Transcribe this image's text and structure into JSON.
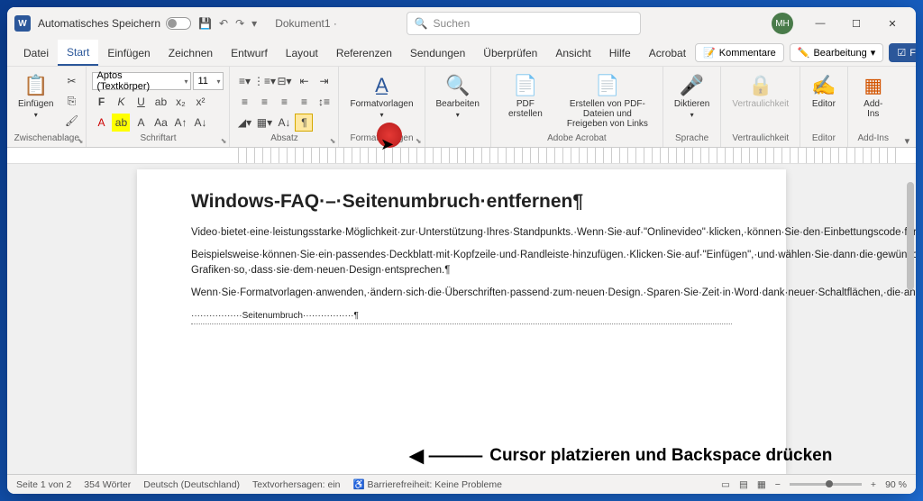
{
  "titlebar": {
    "autosave": "Automatisches Speichern",
    "doctitle": "Dokument1 ·",
    "searchPlaceholder": "Suchen",
    "avatar": "MH"
  },
  "tabs": [
    "Datei",
    "Start",
    "Einfügen",
    "Zeichnen",
    "Entwurf",
    "Layout",
    "Referenzen",
    "Sendungen",
    "Überprüfen",
    "Ansicht",
    "Hilfe",
    "Acrobat"
  ],
  "tabsRight": {
    "comments": "Kommentare",
    "editing": "Bearbeitung",
    "share": "Freigeben"
  },
  "ribbon": {
    "clipboard": {
      "paste": "Einfügen",
      "label": "Zwischenablage"
    },
    "font": {
      "name": "Aptos (Textkörper)",
      "size": "11",
      "label": "Schriftart"
    },
    "paragraph": {
      "label": "Absatz"
    },
    "styles": {
      "btn": "Formatvorlagen",
      "label": "Formatvorlagen"
    },
    "editing": {
      "btn": "Bearbeiten"
    },
    "pdf": {
      "create": "PDF erstellen",
      "createShare": "Erstellen von PDF-Dateien und Freigeben von Links",
      "label": "Adobe Acrobat"
    },
    "dictate": {
      "btn": "Diktieren",
      "label": "Sprache"
    },
    "conf": {
      "btn": "Vertraulichkeit",
      "label": "Vertraulichkeit"
    },
    "editor": {
      "btn": "Editor",
      "label": "Editor"
    },
    "addins": {
      "btn": "Add-Ins",
      "label": "Add-Ins"
    }
  },
  "document": {
    "title": "Windows-FAQ·–·Seitenumbruch·entfernen¶",
    "p1": "Video·bietet·eine·leistungsstarke·Möglichkeit·zur·Unterstützung·Ihres·Standpunkts.·Wenn·Sie·auf·\"Onlinevideo\"·klicken,·können·Sie·den·Einbettungscode·für·das·Video·einfügen,·das·hinzugefügt·werden·soll.·Sie·können·auch·ein·Stichwort·eingeben,·um·online·nach·dem·Videoclip·zu·suchen,·der·optimal·zu·Ihrem·Dokument·passt.·Damit·Ihr·Dokument·ein·professionelles·Aussehen·erhält,·stellt·Word·einander·ergänzende·Designs·für·Kopfzeile,·Fußzeile,·Deckblatt·und·Textfelder·zur·Verfügung.¶",
    "p2": "Beispielsweise·können·Sie·ein·passendes·Deckblatt·mit·Kopfzeile·und·Randleiste·hinzufügen.·Klicken·Sie·auf·\"Einfügen\",·und·wählen·Sie·dann·die·gewünschten·Elemente·aus·den·verschiedenen·Katalogen·aus.·Designs·und·Formatvorlagen·helfen·auch·dabei,·die·Elemente·Ihres·Dokuments·aufeinander·abzustimmen.·Wenn·Sie·auf·\"Entwurf\"·klicken·und·ein·neues·Design·auswählen,·ändern·sich·die·Grafiken,·Diagramme·und·SmartArt-Grafiken·so,·dass·sie·dem·neuen·Design·entsprechen.¶",
    "p3": "Wenn·Sie·Formatvorlagen·anwenden,·ändern·sich·die·Überschriften·passend·zum·neuen·Design.·Sparen·Sie·Zeit·in·Word·dank·neuer·Schaltflächen,·die·angezeigt·werden,·wo·Sie·sie·benötigen.·Zum·Ändern·der·Weise,·in·der·sich·ein·Bild·in·Ihr·Dokument·einfügt,·klicken·Sie·auf·das·Bild.·Dann·wird·eine·Schaltfläche·für·Layoutoptionen·neben·dem·Bild·angezeigt·Beim·Arbeiten·an·einer·Tabelle·klicken·Sie·an·die·Position,·an·der·Sie·eine·Zeile·oder·Spalte·hinzufügen·möchten,·und·klicken·Sie·dann·auf·das·Pluszeichen.¶",
    "pageBreak": "Seitenumbruch"
  },
  "annotation": "Cursor platzieren und Backspace drücken",
  "status": {
    "page": "Seite 1 von 2",
    "words": "354 Wörter",
    "lang": "Deutsch (Deutschland)",
    "predict": "Textvorhersagen: ein",
    "access": "Barrierefreiheit: Keine Probleme",
    "zoom": "90 %"
  }
}
